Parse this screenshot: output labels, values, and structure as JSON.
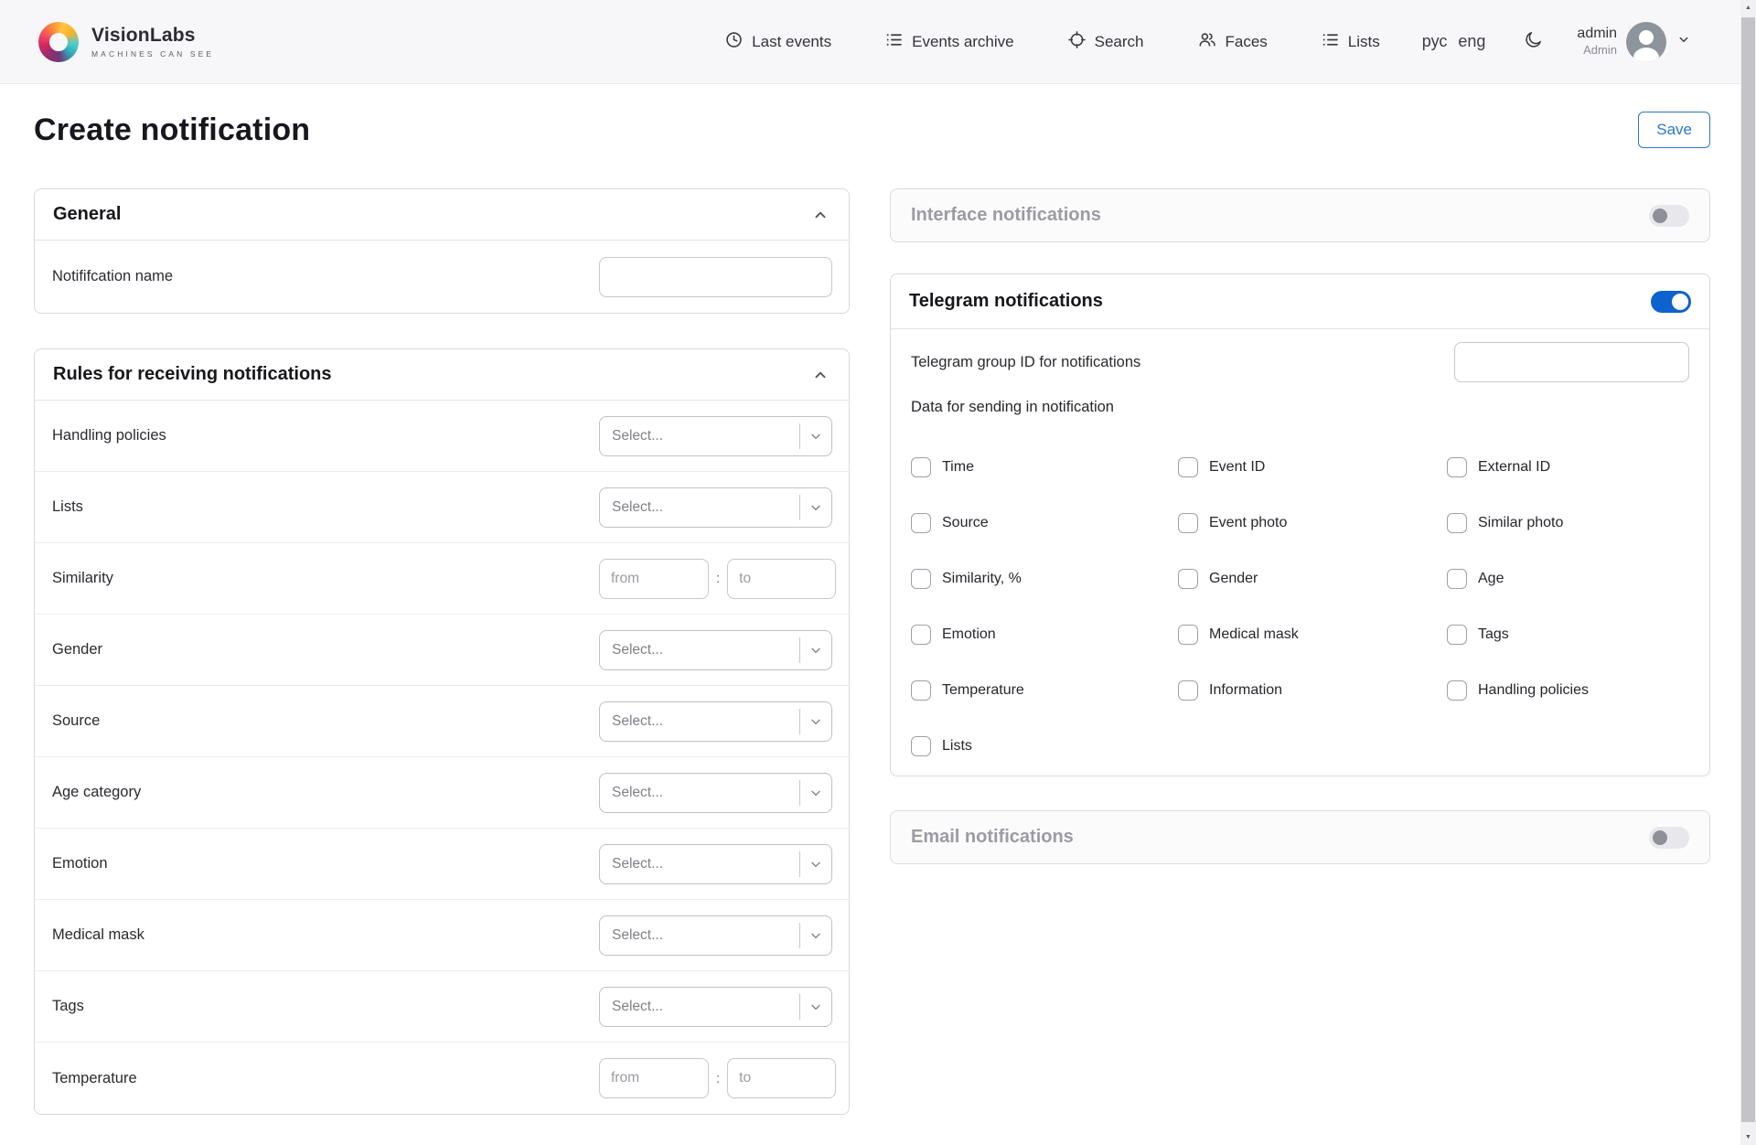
{
  "colors": {
    "accent_blue": "#2b77c5",
    "toggle_on_blue": "#0d63cd",
    "header_bg": "#f7f7f9",
    "disabled_title_gray": "#9b9ba3"
  },
  "header": {
    "brand": {
      "name": "VisionLabs",
      "tagline": "MACHINES CAN SEE"
    },
    "nav": [
      {
        "label": "Last events",
        "icon": "clock-icon"
      },
      {
        "label": "Events archive",
        "icon": "list-icon"
      },
      {
        "label": "Search",
        "icon": "focus-icon"
      },
      {
        "label": "Faces",
        "icon": "people-icon"
      },
      {
        "label": "Lists",
        "icon": "list-icon"
      }
    ],
    "language": {
      "rus": "рус",
      "eng": "eng"
    },
    "theme_icon": "moon-icon",
    "user": {
      "name": "admin",
      "role": "Admin"
    }
  },
  "page": {
    "title": "Create notification",
    "save_label": "Save"
  },
  "general": {
    "title": "General",
    "name_field": {
      "label": "Notififcation name",
      "value": ""
    }
  },
  "rules": {
    "title": "Rules for receiving notifications",
    "select_placeholder": "Select...",
    "range": {
      "from": "from",
      "to": "to",
      "separator": ":"
    },
    "rows": [
      {
        "label": "Handling policies",
        "type": "select"
      },
      {
        "label": "Lists",
        "type": "select"
      },
      {
        "label": "Similarity",
        "type": "range"
      },
      {
        "label": "Gender",
        "type": "select"
      },
      {
        "label": "Source",
        "type": "select"
      },
      {
        "label": "Age category",
        "type": "select"
      },
      {
        "label": "Emotion",
        "type": "select"
      },
      {
        "label": "Medical mask",
        "type": "select"
      },
      {
        "label": "Tags",
        "type": "select"
      },
      {
        "label": "Temperature",
        "type": "range"
      }
    ]
  },
  "interface_notifications": {
    "title": "Interface notifications",
    "enabled": false
  },
  "telegram": {
    "title": "Telegram notifications",
    "enabled": true,
    "group_id_label": "Telegram group ID for notifications",
    "group_id_value": "",
    "data_heading": "Data for sending in notification",
    "checkboxes": [
      "Time",
      "Event ID",
      "External ID",
      "Source",
      "Event photo",
      "Similar photo",
      "Similarity, %",
      "Gender",
      "Age",
      "Emotion",
      "Medical mask",
      "Tags",
      "Temperature",
      "Information",
      "Handling policies",
      "Lists"
    ]
  },
  "email_notifications": {
    "title": "Email notifications",
    "enabled": false
  }
}
